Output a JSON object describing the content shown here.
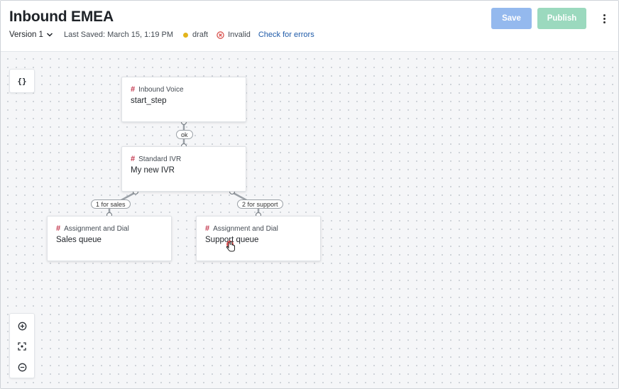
{
  "header": {
    "title": "Inbound EMEA",
    "version_label": "Version 1",
    "last_saved": "Last Saved: March 15, 1:19 PM",
    "status_draft": "draft",
    "status_invalid": "Invalid",
    "check_errors": "Check for errors",
    "save_label": "Save",
    "publish_label": "Publish"
  },
  "canvas": {
    "variables_button": "{}",
    "nodes": [
      {
        "type": "Inbound Voice",
        "name": "start_step"
      },
      {
        "type": "Standard IVR",
        "name": "My new IVR"
      },
      {
        "type": "Assignment and Dial",
        "name": "Sales queue"
      },
      {
        "type": "Assignment and Dial",
        "name": "Support queue"
      }
    ],
    "edges": [
      {
        "label": "ok"
      },
      {
        "label": "1 for sales"
      },
      {
        "label": "2 for support"
      }
    ]
  },
  "colors": {
    "save_button": "#94b9ee",
    "publish_button": "#9bd9be",
    "draft_dot": "#e3b41b",
    "invalid_icon": "#d64541",
    "link": "#1e5aa8",
    "node_hash": "#c2334a"
  },
  "icons": [
    "chevron-down-icon",
    "invalid-x-icon",
    "kebab-menu-icon",
    "zoom-in-icon",
    "fit-view-icon",
    "zoom-out-icon",
    "hand-cursor-icon"
  ]
}
